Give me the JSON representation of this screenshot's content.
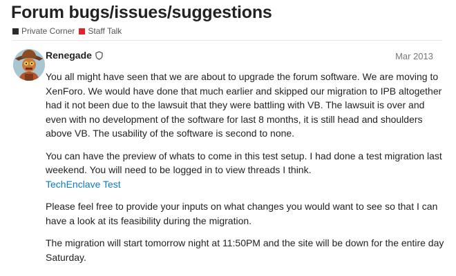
{
  "topic": {
    "title": "Forum bugs/issues/suggestions",
    "categories": [
      {
        "label": "Private Corner",
        "color": "#2b2b2b"
      },
      {
        "label": "Staff Talk",
        "color": "#e0232c"
      }
    ]
  },
  "post": {
    "author": "Renegade",
    "author_badge_icon": "shield-icon",
    "date": "Mar 2013",
    "paragraphs": [
      "You all might have seen that we are about to upgrade the forum software. We are moving to XenForo. We would have done that much earlier and skipped our migration to IPB altogether had it not been due to the lawsuit that they were battling with VB. The lawsuit is over and even with no development of the software for last 8 months, it is still head and shoulders above VB. The usability of the software is second to none.",
      "You can have the preview of whats to come in this test setup. I had done a test migration last weekend. You will need to be logged in to view threads I think.",
      "Please feel free to provide your inputs on what changes you would want to see so that I can have a look at its feasibility during the migration.",
      "The migration will start tomorrow night at 11:50PM and the site will be down for the entire day Saturday."
    ],
    "link_label": "TechEnclave Test"
  },
  "colors": {
    "link": "#0b79c8",
    "text": "#222222",
    "muted": "#777777"
  }
}
